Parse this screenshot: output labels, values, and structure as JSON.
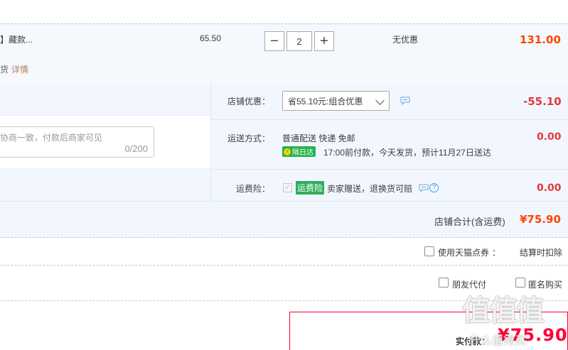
{
  "item": {
    "title": "】藏款...",
    "sub_text": "货",
    "details_link": "详情",
    "unit_price": "65.50",
    "quantity": "2",
    "minus_label": "−",
    "plus_label": "+",
    "discount": "无优惠",
    "line_total": "131.00"
  },
  "shop": {
    "message_placeholder": "协商一致，付款后商家可见",
    "message_count": "0/200",
    "shop_discount_label": "店铺优惠：",
    "shop_discount_option": "省55.10元:组合优惠",
    "shop_discount_amount": "-55.10",
    "shipping_label": "运送方式：",
    "shipping_method": "普通配送 快递 免邮",
    "shipping_badge": "隔日达",
    "shipping_badge_icon": "⚡",
    "shipping_eta": "17:00前付款，今天发货，预计11月27日送达",
    "shipping_amount": "0.00",
    "insurance_label": "运费险：",
    "insurance_tag": "运费险",
    "insurance_text": "卖家赠送，退换货可赔",
    "insurance_amount": "0.00",
    "total_label": "店铺合计(含运费)",
    "total_amount": "¥75.90"
  },
  "coupon": {
    "label": "使用天猫点券",
    "colon": "：",
    "right_text": "结算时扣除"
  },
  "payment": {
    "friend_pay": "朋友代付",
    "anonymous": "匿名购买"
  },
  "final": {
    "label": "实付款：",
    "amount": "¥75.90"
  },
  "watermark": {
    "text": "值值值",
    "sub": "什么值得买"
  },
  "colors": {
    "price_orange": "#ff4400",
    "price_red": "#e4393c",
    "accent_red": "#ff0036",
    "green_badge": "#25b34c"
  }
}
